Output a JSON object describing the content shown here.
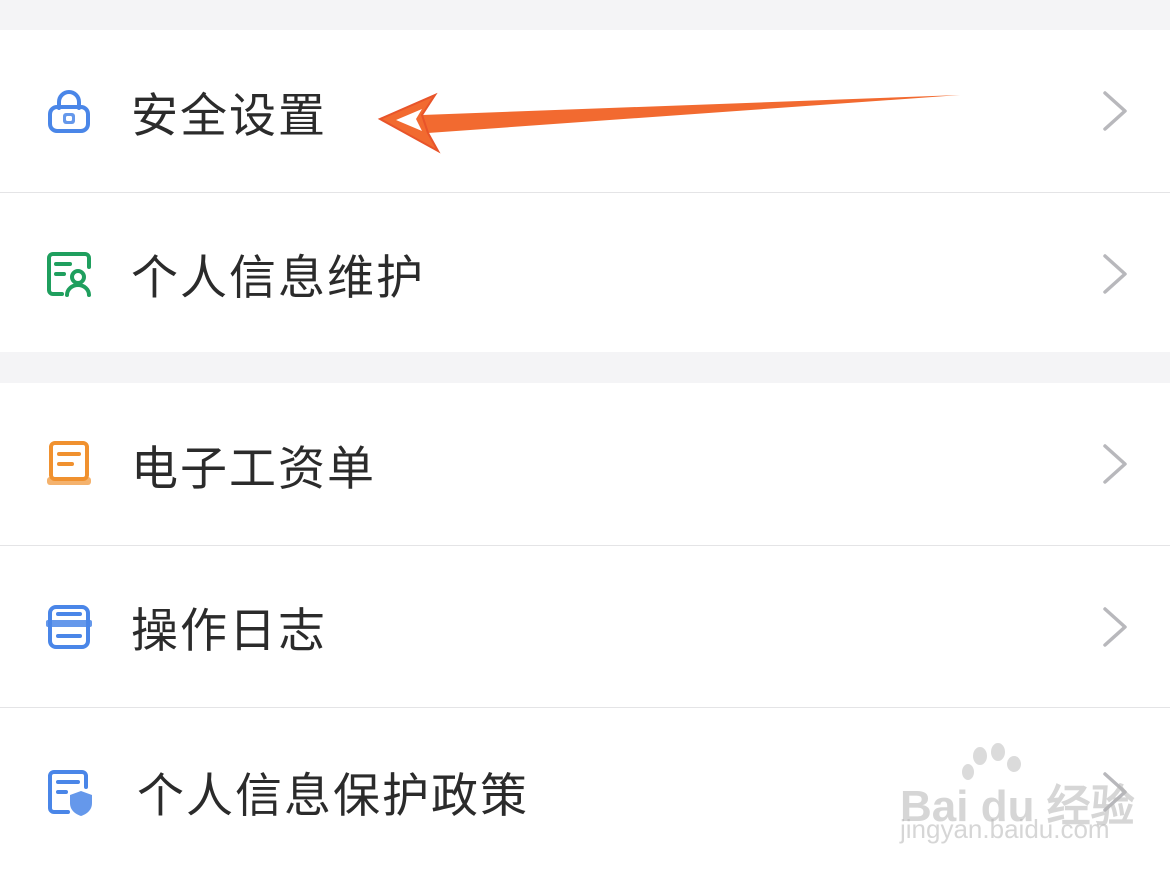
{
  "colors": {
    "background": "#f4f4f6",
    "row_bg": "#ffffff",
    "text": "#2b2b2b",
    "chevron": "#b8b8bc",
    "blue_icon": "#4a86e8",
    "green_icon": "#1f9f5e",
    "orange_icon": "#f0912f",
    "arrow": "#f26a30"
  },
  "groups": [
    {
      "items": [
        {
          "label": "安全设置",
          "icon": "lock-icon"
        },
        {
          "label": "个人信息维护",
          "icon": "profile-card-icon"
        }
      ]
    },
    {
      "items": [
        {
          "label": "电子工资单",
          "icon": "payslip-icon"
        },
        {
          "label": "操作日志",
          "icon": "log-list-icon"
        },
        {
          "label": "个人信息保护政策",
          "icon": "shield-document-icon"
        }
      ]
    }
  ],
  "annotation": {
    "icon": "arrow-annotation-icon"
  },
  "watermark": {
    "main": "Bai du 经验",
    "sub": "jingyan.baidu.com"
  }
}
